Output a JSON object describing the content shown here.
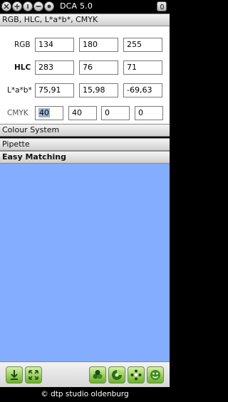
{
  "window": {
    "title": "DCA 5.0",
    "buttons": [
      "close",
      "zoom",
      "info",
      "minimize",
      "record"
    ]
  },
  "sections": {
    "top_label": "RGB, HLC, L*a*b*, CMYK",
    "colour_system": "Colour System",
    "pipette": "Pipette",
    "easy_matching": "Easy Matching"
  },
  "color_values": {
    "rgb": {
      "label": "RGB",
      "values": [
        "134",
        "180",
        "255"
      ]
    },
    "hlc": {
      "label": "HLC",
      "values": [
        "283",
        "76",
        "71"
      ]
    },
    "lab": {
      "label": "L*a*b*",
      "values": [
        "75,91",
        "15,98",
        "-69,63"
      ]
    },
    "cmyk": {
      "label": "CMYK",
      "values": [
        "40",
        "40",
        "0",
        "0"
      ]
    }
  },
  "easy_matching_color": "#84adff",
  "toolbar": {
    "icons": [
      "download-arrow-icon",
      "expand-arrows-icon",
      "color-harmony-icon",
      "color-wheel-icon",
      "flower-dots-icon",
      "smiley-icon"
    ]
  },
  "footer": {
    "text": "© dtp studio oldenburg"
  }
}
